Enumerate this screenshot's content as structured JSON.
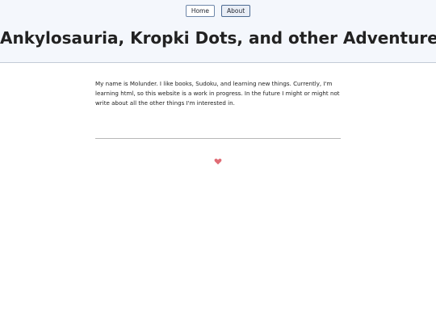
{
  "nav": {
    "items": [
      {
        "label": "Home"
      },
      {
        "label": "About"
      }
    ]
  },
  "header": {
    "title": "Ankylosauria, Kropki Dots, and other Adventures"
  },
  "main": {
    "intro": "My name is Molunder. I like books, Sudoku, and learning new things. Currently, I'm learning html, so this website is a work in progress. In the future I might or might not write about all the other things I'm interested in."
  },
  "footer": {
    "icon": "heart-icon",
    "icon_color": "#e06c75"
  },
  "colors": {
    "header_bg": "#f4f7fc",
    "button_border": "#6f88aa",
    "divider": "#b8b8b8"
  }
}
